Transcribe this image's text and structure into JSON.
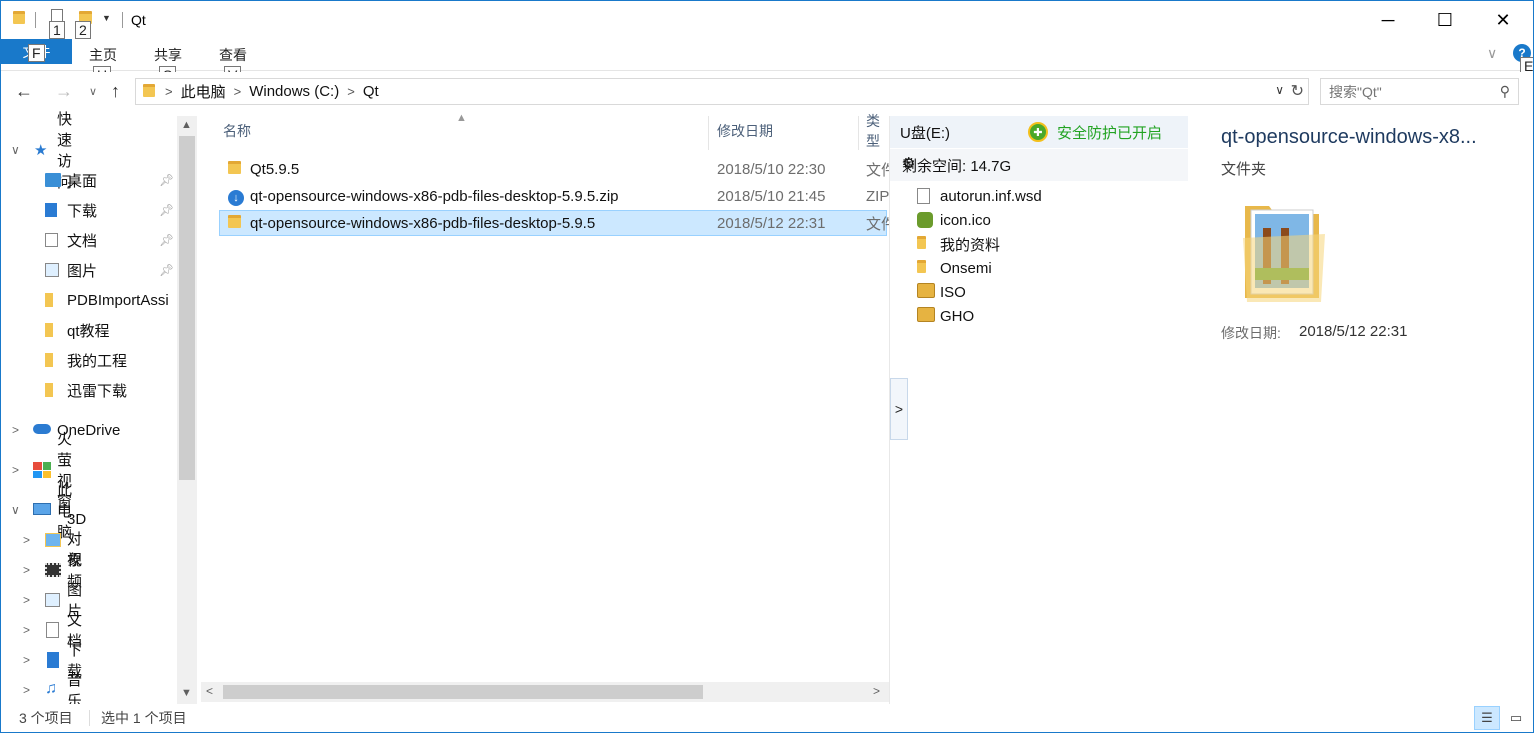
{
  "window": {
    "title": "Qt",
    "minimize_glyph": "─",
    "maximize_glyph": "☐",
    "close_glyph": "✕"
  },
  "keytips": {
    "qa1": "1",
    "qa2": "2",
    "file": "F",
    "home": "H",
    "share": "S",
    "view": "V",
    "help": "E"
  },
  "ribbon": {
    "file_tab": "文件",
    "tabs": [
      "主页",
      "共享",
      "查看"
    ],
    "collapse_glyph": "∨",
    "help_glyph": "?"
  },
  "address": {
    "crumbs": [
      "此电脑",
      "Windows (C:)",
      "Qt"
    ],
    "search_placeholder": "搜索\"Qt\""
  },
  "nav_pane": {
    "quick_access": {
      "label": "快速访问",
      "items": [
        {
          "label": "桌面",
          "pinned": true
        },
        {
          "label": "下载",
          "pinned": true
        },
        {
          "label": "文档",
          "pinned": true
        },
        {
          "label": "图片",
          "pinned": true
        },
        {
          "label": "PDBImportAssi",
          "pinned": false
        },
        {
          "label": "qt教程",
          "pinned": false
        },
        {
          "label": "我的工程",
          "pinned": false
        },
        {
          "label": "迅雷下载",
          "pinned": false
        }
      ]
    },
    "onedrive": "OneDrive",
    "huoying": "火萤视窗",
    "this_pc": {
      "label": "此电脑",
      "items": [
        "3D 对象",
        "视频",
        "图片",
        "文档",
        "下载",
        "音乐"
      ]
    }
  },
  "file_list": {
    "columns": {
      "name": "名称",
      "date": "修改日期",
      "type": "类型"
    },
    "rows": [
      {
        "name": "Qt5.9.5",
        "date": "2018/5/10 22:30",
        "type": "文件夹",
        "icon": "folder-icon",
        "selected": false
      },
      {
        "name": "qt-opensource-windows-x86-pdb-files-desktop-5.9.5.zip",
        "date": "2018/5/10 21:45",
        "type": "ZIP",
        "icon": "zip-icon",
        "selected": false
      },
      {
        "name": "qt-opensource-windows-x86-pdb-files-desktop-5.9.5",
        "date": "2018/5/12 22:31",
        "type": "文件夹",
        "icon": "folder-icon",
        "selected": true
      }
    ]
  },
  "usb_panel": {
    "title": "U盘(E:)",
    "protection": "安全防护已开启",
    "free_space": "剩余空间: 14.7G",
    "items": [
      {
        "label": "autorun.inf.wsd",
        "icon": "file-icon"
      },
      {
        "label": "icon.ico",
        "icon": "ico-file-icon"
      },
      {
        "label": "我的资料",
        "icon": "folder-icon"
      },
      {
        "label": "Onsemi",
        "icon": "folder-icon"
      },
      {
        "label": "ISO",
        "icon": "drive-folder-icon"
      },
      {
        "label": "GHO",
        "icon": "drive-folder-icon"
      }
    ]
  },
  "details": {
    "title": "qt-opensource-windows-x8...",
    "type": "文件夹",
    "modified_label": "修改日期:",
    "modified_value": "2018/5/12 22:31"
  },
  "status": {
    "item_count": "3 个项目",
    "selected_count": "选中 1 个项目"
  },
  "colors": {
    "accent": "#1979ca",
    "selection": "#cce8ff",
    "protection_green": "#22a322"
  }
}
